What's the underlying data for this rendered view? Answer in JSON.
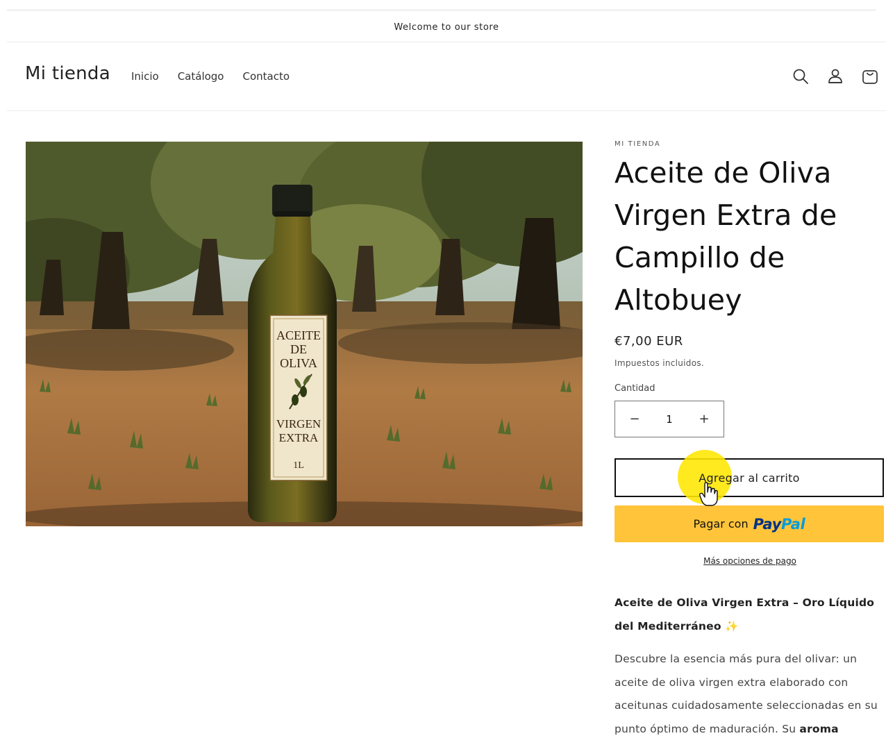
{
  "announcement": {
    "text": "Welcome to our store"
  },
  "header": {
    "logo": "Mi tienda",
    "nav": [
      "Inicio",
      "Catálogo",
      "Contacto"
    ],
    "icons": [
      "search-icon",
      "account-icon",
      "cart-icon"
    ]
  },
  "product": {
    "image_label": {
      "line1": "ACEITE",
      "line2": "DE",
      "line3": "OLIVA",
      "line4": "VIRGEN",
      "line5": "EXTRA",
      "volume": "1L"
    },
    "vendor": "MI TIENDA",
    "title": "Aceite de Oliva Virgen Extra de Campillo de Altobuey",
    "price": "€7,00 EUR",
    "taxes": "Impuestos incluidos.",
    "quantity_label": "Cantidad",
    "quantity_value": "1",
    "qty_minus": "−",
    "qty_plus": "+",
    "add_to_cart": "Agregar al carrito",
    "paypal_prefix": "Pagar con",
    "paypal_brand_a": "Pay",
    "paypal_brand_b": "Pal",
    "more_payment": "Más opciones de pago",
    "description": {
      "title": "Aceite de Oliva Virgen Extra – Oro Líquido del Mediterráneo",
      "title_emoji": "✨",
      "paragraph": "Descubre la esencia más pura del olivar: un aceite de oliva virgen extra elaborado con aceitunas cuidadosamente seleccionadas en su punto óptimo de maduración. Su",
      "paragraph_bold": "aroma"
    }
  },
  "colors": {
    "paypal_yellow": "#ffc439",
    "paypal_blue_dark": "#003087",
    "paypal_blue_light": "#009cde",
    "click_highlight": "#ffe600"
  }
}
